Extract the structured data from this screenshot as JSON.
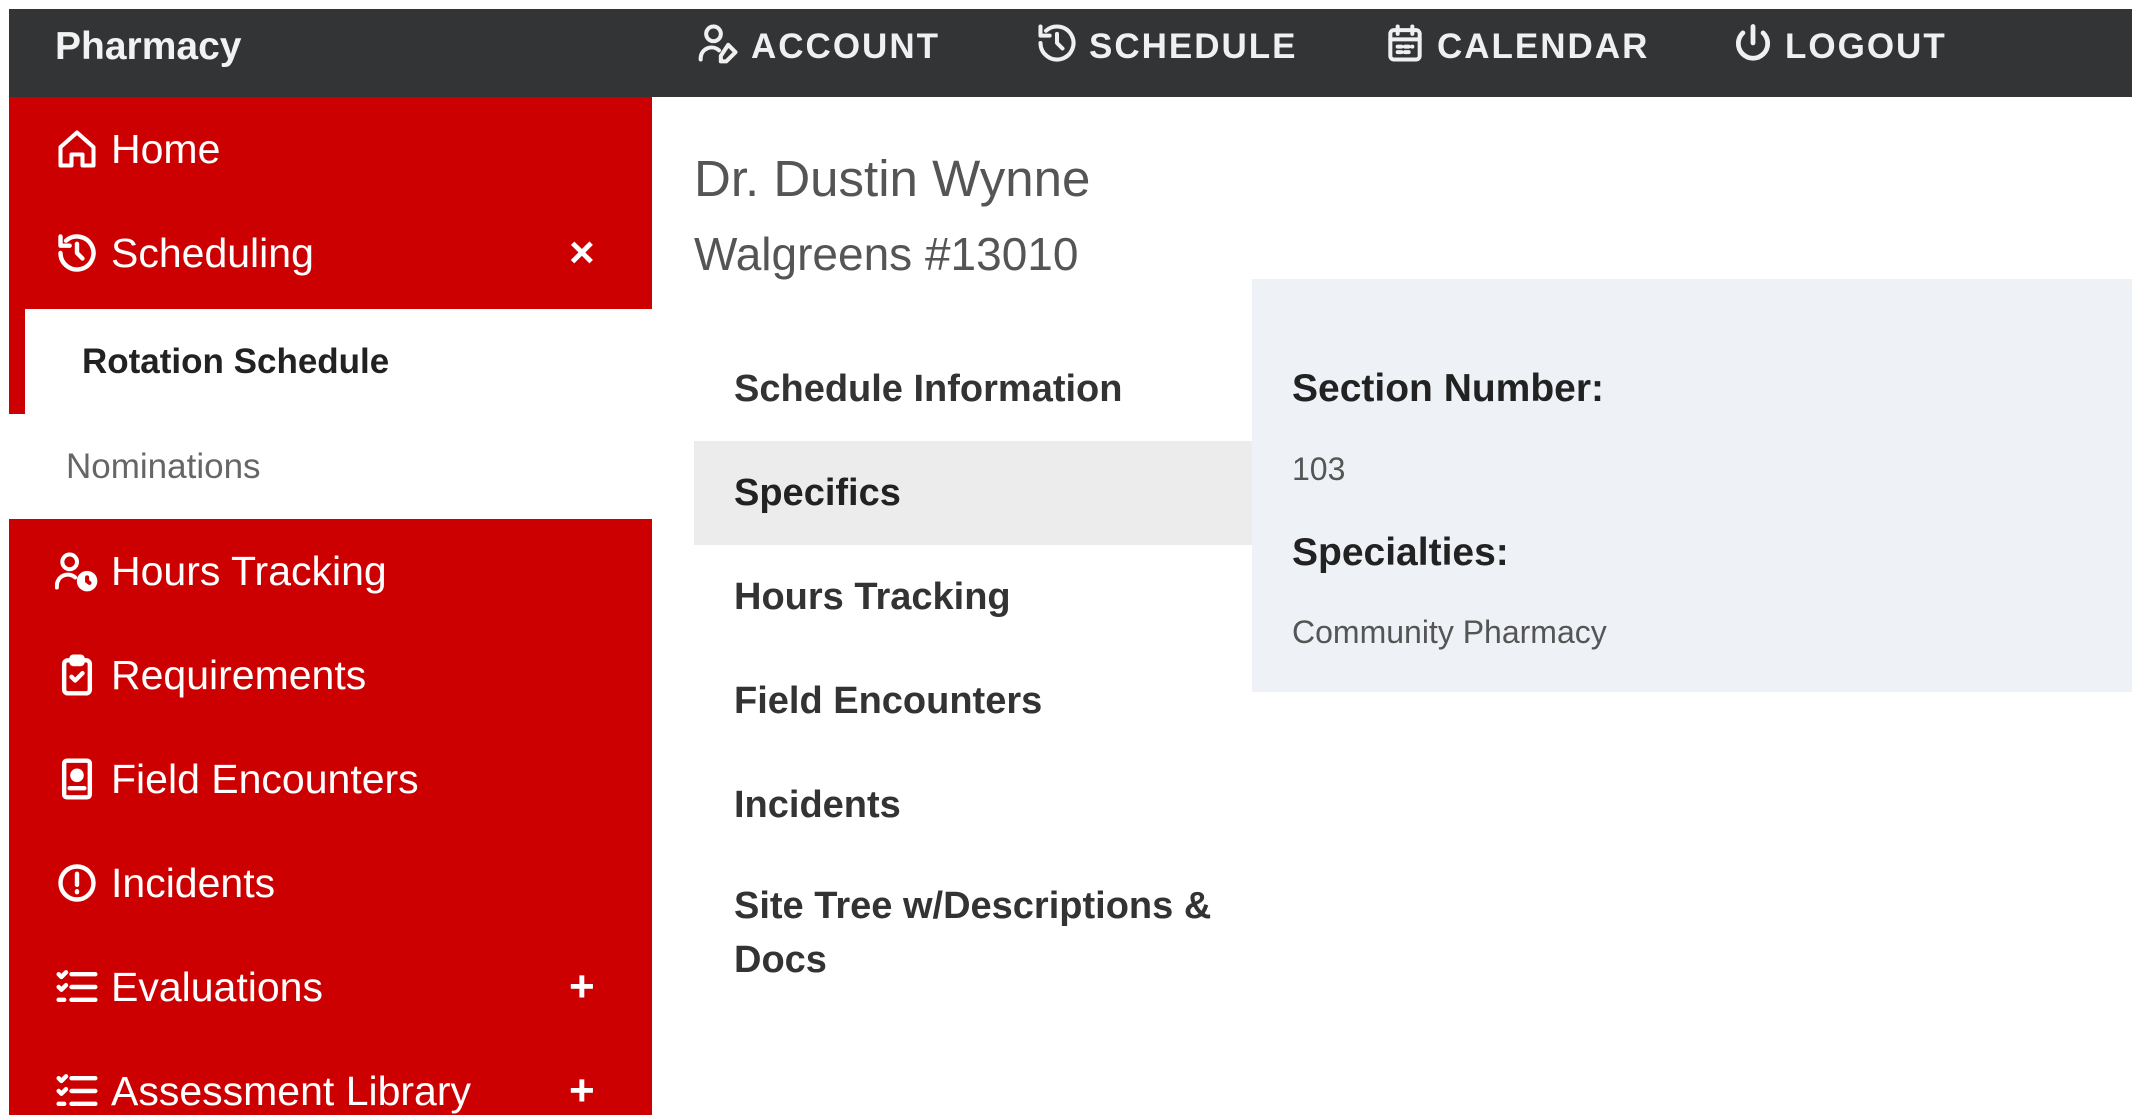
{
  "app": {
    "title": "Pharmacy"
  },
  "topnav": [
    {
      "label": "ACCOUNT",
      "icon": "user-edit-icon"
    },
    {
      "label": "SCHEDULE",
      "icon": "history-icon"
    },
    {
      "label": "CALENDAR",
      "icon": "calendar-icon"
    },
    {
      "label": "LOGOUT",
      "icon": "power-icon"
    }
  ],
  "sidebar": {
    "items": [
      {
        "label": "Home",
        "icon": "home-icon"
      },
      {
        "label": "Scheduling",
        "icon": "history-icon",
        "toggle": "×"
      },
      {
        "label": "Hours Tracking",
        "icon": "user-clock-icon"
      },
      {
        "label": "Requirements",
        "icon": "clipboard-check-icon"
      },
      {
        "label": "Field Encounters",
        "icon": "contact-card-icon"
      },
      {
        "label": "Incidents",
        "icon": "alert-circle-icon"
      },
      {
        "label": "Evaluations",
        "icon": "checklist-icon",
        "toggle": "+"
      },
      {
        "label": "Assessment Library",
        "icon": "checklist-icon",
        "toggle": "+"
      }
    ],
    "submenu": [
      {
        "label": "Rotation Schedule",
        "active": true
      },
      {
        "label": "Nominations",
        "active": false
      }
    ]
  },
  "main": {
    "doctor_name": "Dr. Dustin Wynne",
    "site_name": "Walgreens #13010",
    "tabs": [
      {
        "label": "Schedule Information"
      },
      {
        "label": "Specifics",
        "active": true
      },
      {
        "label": "Hours Tracking"
      },
      {
        "label": "Field Encounters"
      },
      {
        "label": "Incidents"
      },
      {
        "label": "Site Tree w/Descriptions & Docs"
      }
    ],
    "details": {
      "section_number_label": "Section Number:",
      "section_number_value": "103",
      "specialties_label": "Specialties:",
      "specialties_value": "Community Pharmacy"
    }
  },
  "colors": {
    "topbar": "#333436",
    "sidebar": "#cc0000",
    "panel": "#eef2f6",
    "active_tab": "#ececec"
  }
}
